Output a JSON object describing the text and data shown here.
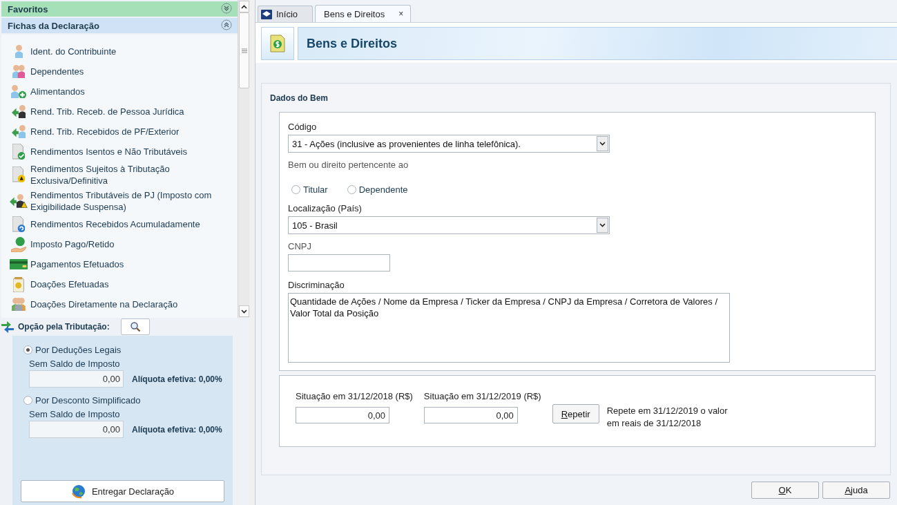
{
  "sidebar": {
    "favorites": {
      "title": "Favoritos",
      "expanded": false
    },
    "section": {
      "title": "Fichas da Declaração",
      "expanded": true
    },
    "items": [
      {
        "label": "Ident. do Contribuinte",
        "kind": "person"
      },
      {
        "label": "Dependentes",
        "kind": "people"
      },
      {
        "label": "Alimentandos",
        "kind": "person-add"
      },
      {
        "label": "Rend. Trib. Receb. de Pessoa Jurídica",
        "kind": "arrow-badge"
      },
      {
        "label": "Rend. Trib. Recebidos de PF/Exterior",
        "kind": "arrow-person"
      },
      {
        "label": "Rendimentos Isentos e Não Tributáveis",
        "kind": "doc-check"
      },
      {
        "label": "Rendimentos Sujeitos à Tributação Exclusiva/Definitiva",
        "kind": "doc-warning"
      },
      {
        "label": "Rendimentos Tributáveis de PJ (Imposto com Exigibilidade Suspensa)",
        "kind": "arrow-warning"
      },
      {
        "label": "Rendimentos Recebidos Acumuladamente",
        "kind": "doc-refresh"
      },
      {
        "label": "Imposto Pago/Retido",
        "kind": "money-hand"
      },
      {
        "label": "Pagamentos Efetuados",
        "kind": "card"
      },
      {
        "label": "Doações Efetuadas",
        "kind": "money-jar"
      },
      {
        "label": "Doações Diretamente na Declaração",
        "kind": "group"
      }
    ]
  },
  "taxation": {
    "title": "Opção pela Tributação:",
    "options": [
      {
        "label": "Por Deduções Legais",
        "selected": true,
        "status": "Sem Saldo de Imposto",
        "value": "0,00",
        "rate": "Alíquota efetiva: 0,00%"
      },
      {
        "label": "Por Desconto Simplificado",
        "selected": false,
        "status": "Sem Saldo de Imposto",
        "value": "0,00",
        "rate": "Alíquota efetiva: 0,00%"
      }
    ],
    "submit": "Entregar Declaração"
  },
  "tabs": [
    {
      "label": "Início",
      "selected": false,
      "kind": "home"
    },
    {
      "label": "Bens e Direitos",
      "selected": true,
      "kind": "page",
      "close": "×"
    }
  ],
  "page": {
    "title": "Bens e Direitos"
  },
  "form": {
    "title": "Dados do Bem",
    "code": {
      "label": "Código",
      "value": "31 - Ações (inclusive as provenientes de linha telefônica)."
    },
    "owner": {
      "label": "Bem ou direito pertencente ao",
      "options": [
        {
          "label": "Titular",
          "selected": false
        },
        {
          "label": "Dependente",
          "selected": false
        }
      ]
    },
    "location": {
      "label": "Localização (País)",
      "value": "105 - Brasil"
    },
    "cnpj": {
      "label": "CNPJ"
    },
    "description": {
      "label": "Discriminação",
      "value": "Quantidade de Ações / Nome da Empresa / Ticker da Empresa / CNPJ da Empresa / Corretora de Valores / Valor Total da Posição"
    },
    "situation": [
      {
        "label": "Situação em 31/12/2018 (R$)",
        "value": "0,00"
      },
      {
        "label": "Situação em 31/12/2019 (R$)",
        "value": "0,00"
      }
    ],
    "repeat": {
      "button": "Repetir",
      "note": "Repete em 31/12/2019 o valor em reais de 31/12/2018"
    }
  },
  "buttons": [
    "OK",
    "Ajuda"
  ]
}
